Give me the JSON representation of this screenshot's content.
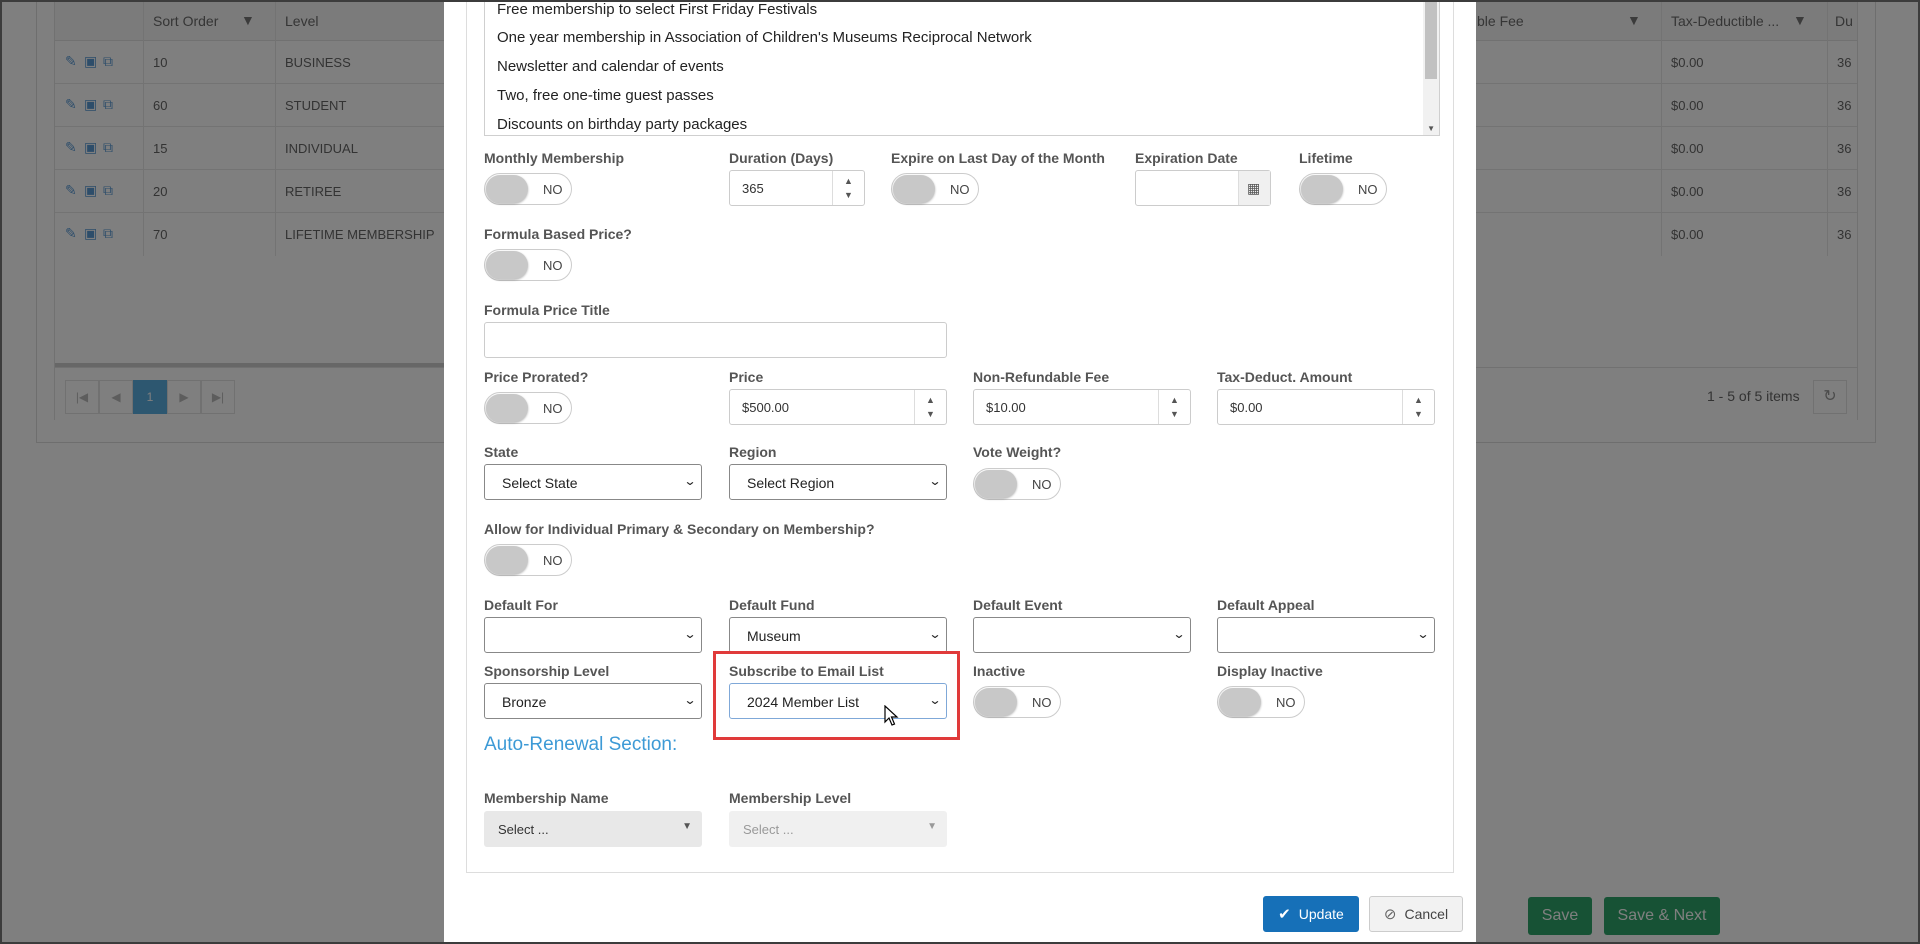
{
  "background_grid": {
    "headers": {
      "sort_order": "Sort Order",
      "level": "Level",
      "fee": "ble Fee",
      "tax": "Tax-Deductible ...",
      "du": "Du"
    },
    "rows": [
      {
        "sort": "10",
        "level": "BUSINESS",
        "tax": "$0.00",
        "du": "36"
      },
      {
        "sort": "60",
        "level": "STUDENT",
        "tax": "$0.00",
        "du": "36"
      },
      {
        "sort": "15",
        "level": "INDIVIDUAL",
        "tax": "$0.00",
        "du": "36"
      },
      {
        "sort": "20",
        "level": "RETIREE",
        "tax": "$0.00",
        "du": "36"
      },
      {
        "sort": "70",
        "level": "LIFETIME MEMBERSHIP",
        "tax": "$0.00",
        "du": "36"
      }
    ],
    "pager": {
      "current_page": "1",
      "summary": "1 - 5 of 5 items"
    },
    "save_label": "Save",
    "save_next_label": "Save & Next"
  },
  "benefits": [
    "Free membership to select First Friday Festivals",
    "One year membership in Association of Children's Museums Reciprocal Network",
    "Newsletter and calendar of events",
    "Two, free one-time guest passes",
    "Discounts on birthday party packages"
  ],
  "form": {
    "monthly_membership": {
      "label": "Monthly Membership",
      "value": "NO"
    },
    "duration": {
      "label": "Duration (Days)",
      "value": "365"
    },
    "expire_last_day": {
      "label": "Expire on Last Day of the Month",
      "value": "NO"
    },
    "expiration_date": {
      "label": "Expiration Date",
      "value": ""
    },
    "lifetime": {
      "label": "Lifetime",
      "value": "NO"
    },
    "formula_based_price": {
      "label": "Formula Based Price?",
      "value": "NO"
    },
    "formula_price_title": {
      "label": "Formula Price Title",
      "value": ""
    },
    "price_prorated": {
      "label": "Price Prorated?",
      "value": "NO"
    },
    "price": {
      "label": "Price",
      "value": "$500.00"
    },
    "non_refundable_fee": {
      "label": "Non-Refundable Fee",
      "value": "$10.00"
    },
    "tax_deduct_amount": {
      "label": "Tax-Deduct. Amount",
      "value": "$0.00"
    },
    "state": {
      "label": "State",
      "value": "Select State"
    },
    "region": {
      "label": "Region",
      "value": "Select Region"
    },
    "vote_weight": {
      "label": "Vote Weight?",
      "value": "NO"
    },
    "allow_primary_secondary": {
      "label": "Allow for Individual Primary & Secondary on Membership?",
      "value": "NO"
    },
    "default_for": {
      "label": "Default For",
      "value": ""
    },
    "default_fund": {
      "label": "Default Fund",
      "value": "Museum"
    },
    "default_event": {
      "label": "Default Event",
      "value": ""
    },
    "default_appeal": {
      "label": "Default Appeal",
      "value": ""
    },
    "sponsorship_level": {
      "label": "Sponsorship Level",
      "value": "Bronze"
    },
    "subscribe_email_list": {
      "label": "Subscribe to Email List",
      "value": "2024 Member List"
    },
    "inactive": {
      "label": "Inactive",
      "value": "NO"
    },
    "display_inactive": {
      "label": "Display Inactive",
      "value": "NO"
    }
  },
  "auto_renewal": {
    "title": "Auto-Renewal Section:",
    "membership_name": {
      "label": "Membership Name",
      "value": "Select ..."
    },
    "membership_level": {
      "label": "Membership Level",
      "value": "Select ..."
    }
  },
  "actions": {
    "update": "Update",
    "cancel": "Cancel"
  },
  "colors": {
    "accent": "#1670b8",
    "highlight": "#e03a3a",
    "section_title": "#3d9ad6"
  }
}
